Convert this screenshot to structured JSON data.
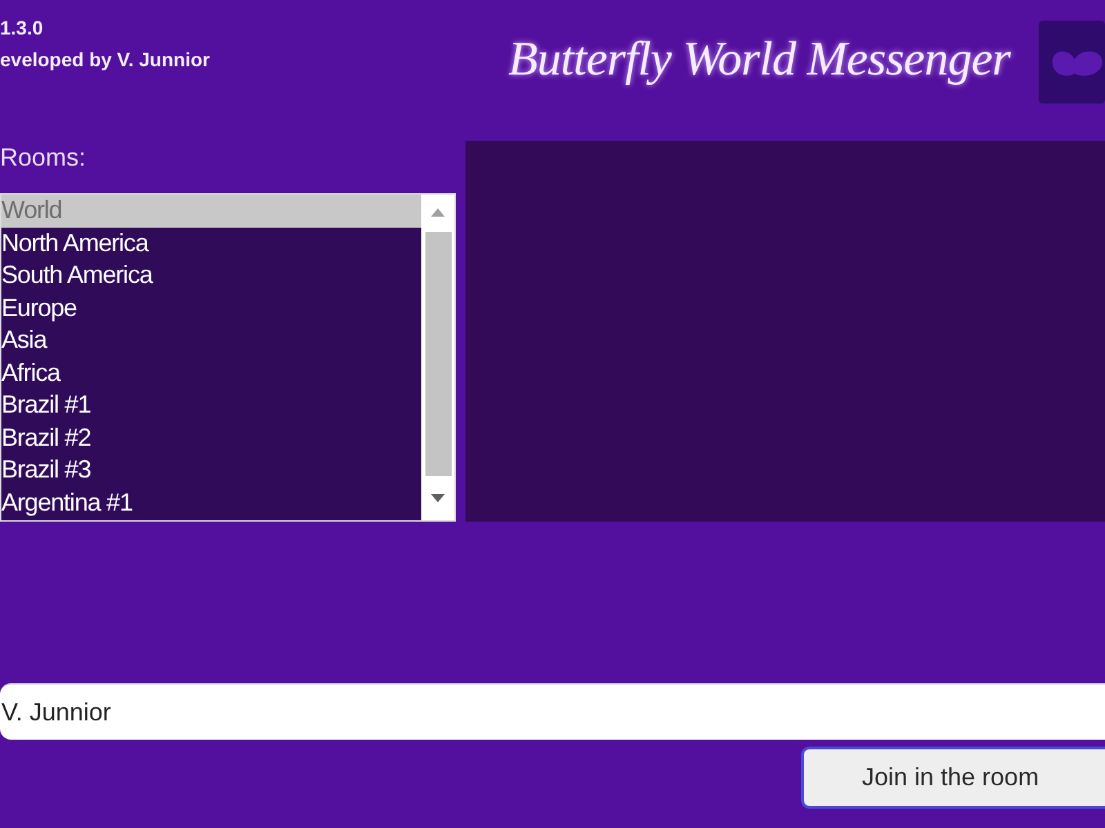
{
  "header": {
    "version": "1.3.0",
    "credit": "eveloped by V. Junnior",
    "app_title": "Butterfly World Messenger"
  },
  "rooms": {
    "label": "Rooms:",
    "items": [
      {
        "name": "World",
        "selected": true
      },
      {
        "name": "North America",
        "selected": false
      },
      {
        "name": "South America",
        "selected": false
      },
      {
        "name": "Europe",
        "selected": false
      },
      {
        "name": "Asia",
        "selected": false
      },
      {
        "name": "Africa",
        "selected": false
      },
      {
        "name": "Brazil #1",
        "selected": false
      },
      {
        "name": "Brazil #2",
        "selected": false
      },
      {
        "name": "Brazil #3",
        "selected": false
      },
      {
        "name": "Argentina #1",
        "selected": false
      }
    ]
  },
  "name_field": {
    "value": "V. Junnior"
  },
  "buttons": [
    {
      "label": "Join in the room",
      "focused": true
    }
  ]
}
